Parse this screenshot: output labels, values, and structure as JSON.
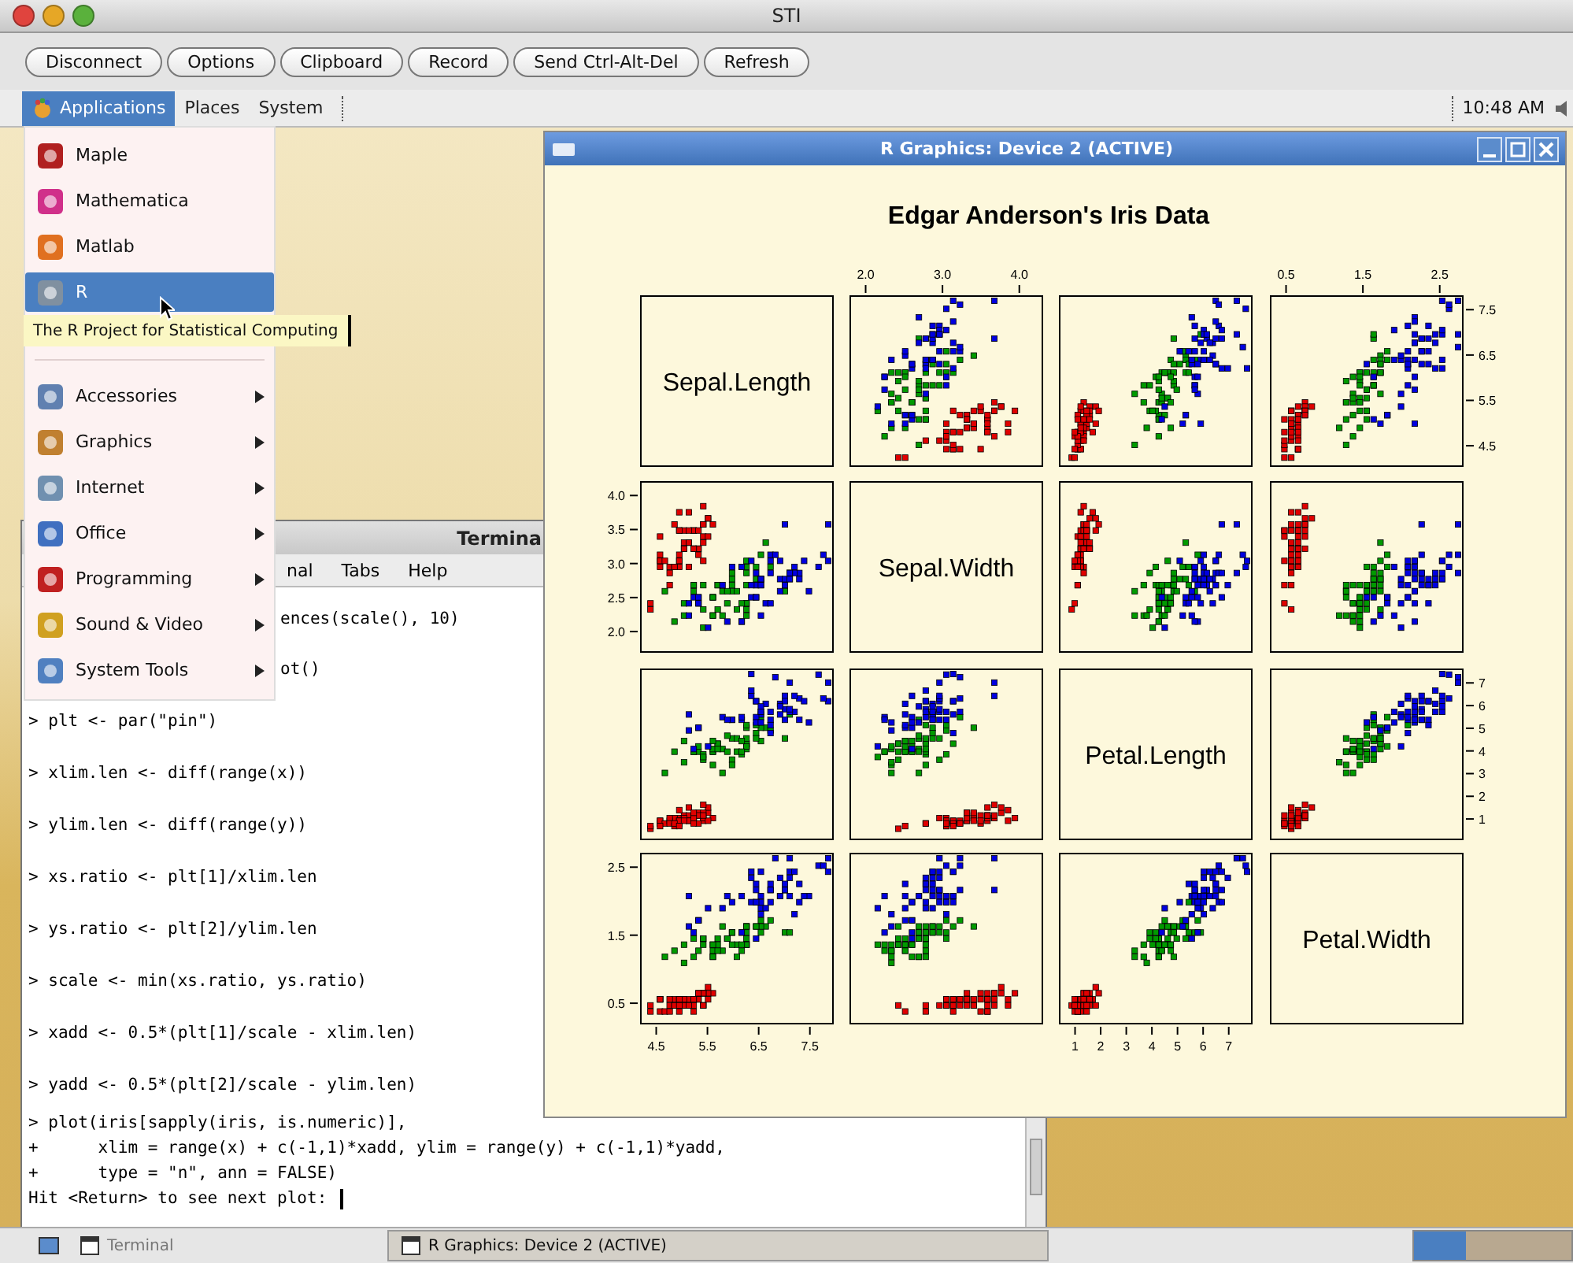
{
  "mac_window": {
    "title": "STI"
  },
  "vnc_toolbar": {
    "buttons": [
      "Disconnect",
      "Options",
      "Clipboard",
      "Record",
      "Send Ctrl-Alt-Del",
      "Refresh"
    ]
  },
  "top_panel": {
    "menus": [
      {
        "label": "Applications",
        "selected": true
      },
      {
        "label": "Places",
        "selected": false
      },
      {
        "label": "System",
        "selected": false
      }
    ],
    "clock": "10:48 AM"
  },
  "applications_menu": {
    "sections": [
      [
        {
          "label": "Maple",
          "selected": false,
          "has_submenu": false
        },
        {
          "label": "Mathematica",
          "selected": false,
          "has_submenu": false
        },
        {
          "label": "Matlab",
          "selected": false,
          "has_submenu": false
        },
        {
          "label": "R",
          "selected": true,
          "has_submenu": false
        }
      ],
      [
        {
          "label": "Accessories",
          "selected": false,
          "has_submenu": true
        },
        {
          "label": "Graphics",
          "selected": false,
          "has_submenu": true
        },
        {
          "label": "Internet",
          "selected": false,
          "has_submenu": true
        },
        {
          "label": "Office",
          "selected": false,
          "has_submenu": true
        },
        {
          "label": "Programming",
          "selected": false,
          "has_submenu": true
        },
        {
          "label": "Sound & Video",
          "selected": false,
          "has_submenu": true
        },
        {
          "label": "System Tools",
          "selected": false,
          "has_submenu": true
        }
      ]
    ],
    "tooltip": "The R Project for Statistical Computing"
  },
  "terminal": {
    "title": "Termina",
    "menus": [
      "nal",
      "Tabs",
      "Help"
    ],
    "lines": [
      {
        "kind": "partial",
        "text": "ences(scale(), 10)"
      },
      {
        "kind": "partial",
        "text": "ot()"
      },
      {
        "kind": "spaced",
        "text": "> plt <- par(\"pin\")"
      },
      {
        "kind": "spaced",
        "text": "> xlim.len <- diff(range(x))"
      },
      {
        "kind": "spaced",
        "text": "> ylim.len <- diff(range(y))"
      },
      {
        "kind": "spaced",
        "text": "> xs.ratio <- plt[1]/xlim.len"
      },
      {
        "kind": "spaced",
        "text": "> ys.ratio <- plt[2]/ylim.len"
      },
      {
        "kind": "spaced",
        "text": "> scale <- min(xs.ratio, ys.ratio)"
      },
      {
        "kind": "spaced",
        "text": "> xadd <- 0.5*(plt[1]/scale - xlim.len)"
      },
      {
        "kind": "spaced",
        "text": "> yadd <- 0.5*(plt[2]/scale - ylim.len)"
      },
      {
        "kind": "plain",
        "text": "> plot(iris[sapply(iris, is.numeric)],"
      },
      {
        "kind": "plain",
        "text": "+      xlim = range(x) + c(-1,1)*xadd, ylim = range(y) + c(-1,1)*yadd,"
      },
      {
        "kind": "plain",
        "text": "+      type = \"n\", ann = FALSE)"
      },
      {
        "kind": "prompt",
        "text": "Hit <Return> to see next plot:"
      }
    ]
  },
  "graphics_window": {
    "title": "R Graphics: Device 2 (ACTIVE)",
    "plot": {
      "title": "Edgar Anderson's Iris Data",
      "variables": [
        "Sepal.Length",
        "Sepal.Width",
        "Petal.Length",
        "Petal.Width"
      ],
      "axes": {
        "top": {
          "column_2": [
            "2.0",
            "3.0",
            "4.0"
          ],
          "column_4": [
            "0.5",
            "1.5",
            "2.5"
          ]
        },
        "right": {
          "row_1": [
            "7.5",
            "6.5",
            "5.5",
            "4.5"
          ],
          "row_3": [
            "7",
            "6",
            "5",
            "4",
            "3",
            "2",
            "1"
          ]
        },
        "left": {
          "row_2": [
            "4.0",
            "3.5",
            "3.0",
            "2.5",
            "2.0"
          ],
          "row_4": [
            "2.5",
            "1.5",
            "0.5"
          ]
        },
        "bottom": {
          "column_1": [
            "4.5",
            "5.5",
            "6.5",
            "7.5"
          ],
          "column_3": [
            "1",
            "2",
            "3",
            "4",
            "5",
            "6",
            "7"
          ]
        }
      }
    }
  },
  "taskbar": {
    "tasks": [
      {
        "label": "Terminal",
        "selected": false
      },
      {
        "label": "R Graphics: Device 2 (ACTIVE)",
        "selected": true
      }
    ]
  }
}
